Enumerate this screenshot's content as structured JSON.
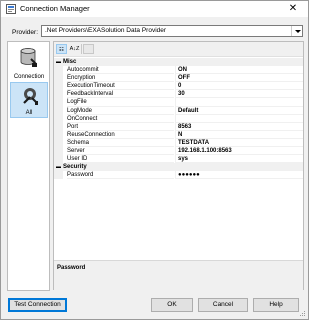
{
  "window": {
    "title": "Connection Manager",
    "close_glyph": "✕"
  },
  "provider": {
    "label": "Provider:",
    "value": ".Net Providers\\EXASolution Data Provider"
  },
  "sidebar": {
    "items": [
      {
        "label": "Connection",
        "icon": "database-plug-icon",
        "selected": false
      },
      {
        "label": "All",
        "icon": "tools-icon",
        "selected": true
      }
    ]
  },
  "toolbar": {
    "categorized_label": "☷",
    "alphabetical_label": "A↓Z"
  },
  "grid": {
    "categories": [
      {
        "name": "Misc",
        "properties": [
          {
            "name": "Autocommit",
            "value": "ON"
          },
          {
            "name": "Encryption",
            "value": "OFF"
          },
          {
            "name": "ExecutionTimeout",
            "value": "0"
          },
          {
            "name": "FeedbackInterval",
            "value": "30"
          },
          {
            "name": "LogFile",
            "value": ""
          },
          {
            "name": "LogMode",
            "value": "Default"
          },
          {
            "name": "OnConnect",
            "value": ""
          },
          {
            "name": "Port",
            "value": "8563"
          },
          {
            "name": "ReuseConnection",
            "value": "N"
          },
          {
            "name": "Schema",
            "value": "TESTDATA"
          },
          {
            "name": "Server",
            "value": "192.168.1.100:8563"
          },
          {
            "name": "User ID",
            "value": "sys"
          }
        ]
      },
      {
        "name": "Security",
        "properties": [
          {
            "name": "Password",
            "value": "●●●●●●"
          }
        ]
      }
    ],
    "collapse_glyph": "▬"
  },
  "description": {
    "title": "Password"
  },
  "buttons": {
    "test": "Test Connection",
    "ok": "OK",
    "cancel": "Cancel",
    "help": "Help"
  },
  "colors": {
    "accent": "#0078d7",
    "selected_bg": "#cce4f7"
  }
}
